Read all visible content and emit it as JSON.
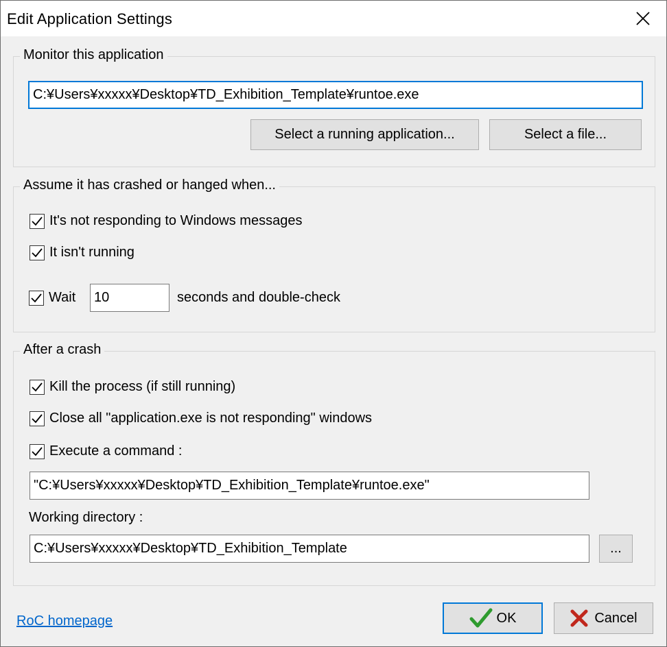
{
  "window": {
    "title": "Edit Application Settings"
  },
  "monitor": {
    "legend": "Monitor this application",
    "path_value": "C:¥Users¥xxxxx¥Desktop¥TD_Exhibition_Template¥runtoe.exe",
    "select_running_label": "Select a running application...",
    "select_file_label": "Select a file..."
  },
  "assume": {
    "legend": "Assume it has crashed or hanged when...",
    "not_responding_label": "It's not responding to Windows messages",
    "not_responding_checked": true,
    "not_running_label": "It isn't running",
    "not_running_checked": true,
    "wait_label": "Wait",
    "wait_checked": true,
    "wait_value": "10",
    "wait_suffix": "seconds and double-check"
  },
  "after": {
    "legend": "After a crash",
    "kill_label": "Kill the process (if still running)",
    "kill_checked": true,
    "close_label": "Close all \"application.exe is not responding\" windows",
    "close_checked": true,
    "execute_label": "Execute a command :",
    "execute_checked": true,
    "command_value": "\"C:¥Users¥xxxxx¥Desktop¥TD_Exhibition_Template¥runtoe.exe\"",
    "workdir_label": "Working directory :",
    "workdir_value": "C:¥Users¥xxxxx¥Desktop¥TD_Exhibition_Template",
    "browse_label": "..."
  },
  "footer": {
    "homepage_link": "RoC homepage",
    "ok_label": "OK",
    "cancel_label": "Cancel"
  },
  "colors": {
    "accent": "#0078d7",
    "ok_icon": "#2e9b2e",
    "cancel_icon": "#c0271c",
    "link": "#0066cc"
  },
  "icons": {
    "close": "close-icon",
    "check": "checkmark-icon",
    "ok": "green-check-icon",
    "cancel": "red-x-icon"
  }
}
